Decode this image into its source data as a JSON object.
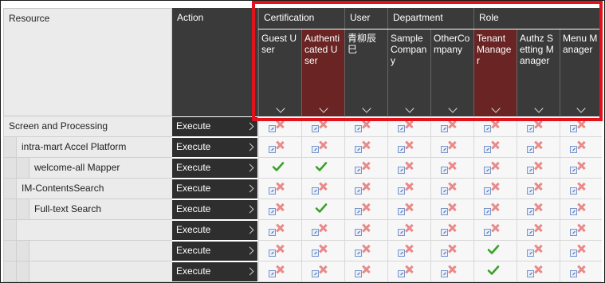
{
  "header": {
    "resource": "Resource",
    "action": "Action",
    "groups": [
      "Certification",
      "User",
      "Department",
      "Role"
    ],
    "columns": [
      {
        "label": "Guest User",
        "selected": false
      },
      {
        "label": "Authenticated User",
        "selected": true
      },
      {
        "label": "青柳辰巳",
        "selected": false
      },
      {
        "label": "Sample Company",
        "selected": false
      },
      {
        "label": "OtherCompany",
        "selected": false
      },
      {
        "label": "Tenant Manager",
        "selected": true
      },
      {
        "label": "Authz Setting Manager",
        "selected": false
      },
      {
        "label": "Menu Manager",
        "selected": false
      }
    ]
  },
  "colors": {
    "header_bg": "#3a3a3a",
    "selected_col": "#6a2424",
    "highlight": "#e0121c",
    "ok": "#3aa22a"
  },
  "rows": [
    {
      "resource": "Screen and Processing",
      "indent": 0,
      "action": "Execute",
      "cells": [
        "deny",
        "deny",
        "deny",
        "deny",
        "deny",
        "deny",
        "deny",
        "deny"
      ]
    },
    {
      "resource": "intra-mart Accel Platform",
      "indent": 1,
      "action": "Execute",
      "cells": [
        "deny",
        "deny",
        "deny",
        "deny",
        "deny",
        "deny",
        "deny",
        "deny"
      ]
    },
    {
      "resource": "welcome-all Mapper",
      "indent": 2,
      "action": "Execute",
      "cells": [
        "allow",
        "allow",
        "deny",
        "deny",
        "deny",
        "deny",
        "deny",
        "deny"
      ]
    },
    {
      "resource": "IM-ContentsSearch",
      "indent": 1,
      "action": "Execute",
      "cells": [
        "deny",
        "deny",
        "deny",
        "deny",
        "deny",
        "deny",
        "deny",
        "deny"
      ]
    },
    {
      "resource": "Full-text Search",
      "indent": 2,
      "action": "Execute",
      "cells": [
        "deny",
        "allow",
        "deny",
        "deny",
        "deny",
        "deny",
        "deny",
        "deny"
      ]
    },
    {
      "resource": "",
      "indent": 1,
      "action": "Execute",
      "cells": [
        "deny",
        "deny",
        "deny",
        "deny",
        "deny",
        "deny",
        "deny",
        "deny"
      ]
    },
    {
      "resource": "",
      "indent": 2,
      "action": "Execute",
      "cells": [
        "deny",
        "deny",
        "deny",
        "deny",
        "deny",
        "allow",
        "deny",
        "deny"
      ]
    },
    {
      "resource": "",
      "indent": 2,
      "action": "Execute",
      "cells": [
        "deny",
        "deny",
        "deny",
        "deny",
        "deny",
        "allow",
        "deny",
        "deny"
      ]
    }
  ]
}
